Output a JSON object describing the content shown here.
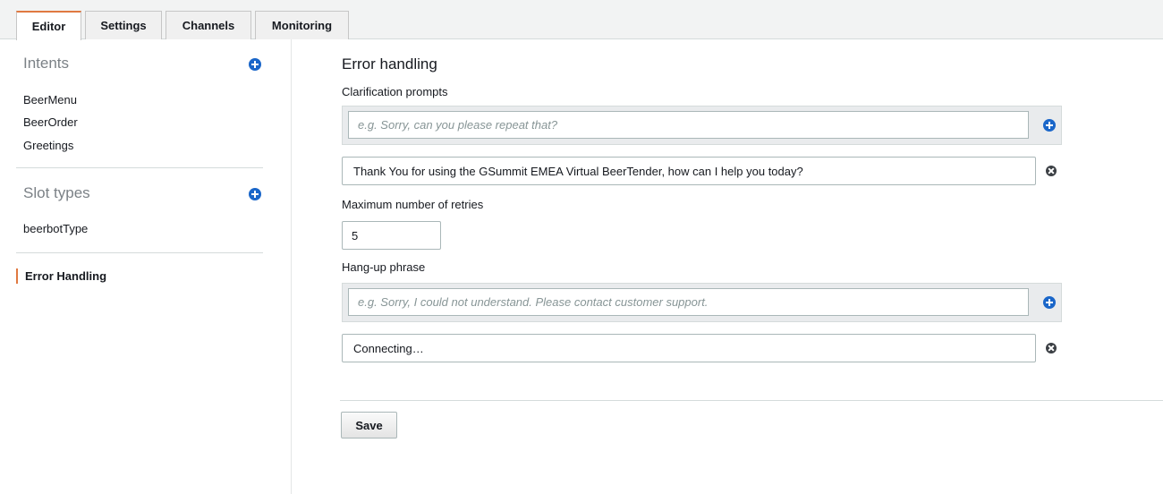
{
  "tabs": [
    {
      "label": "Editor",
      "active": true
    },
    {
      "label": "Settings",
      "active": false
    },
    {
      "label": "Channels",
      "active": false
    },
    {
      "label": "Monitoring",
      "active": false
    }
  ],
  "sidebar": {
    "intents_heading": "Intents",
    "intents": [
      "BeerMenu",
      "BeerOrder",
      "Greetings"
    ],
    "slot_types_heading": "Slot types",
    "slot_types": [
      "beerbotType"
    ],
    "error_handling": "Error Handling"
  },
  "main": {
    "title": "Error handling",
    "clarification": {
      "label": "Clarification prompts",
      "placeholder": "e.g. Sorry, can you please repeat that?",
      "value": "Thank You for using the GSummit EMEA Virtual BeerTender, how can I help you today?"
    },
    "retries": {
      "label": "Maximum number of retries",
      "value": "5"
    },
    "hangup": {
      "label": "Hang-up phrase",
      "placeholder": "e.g. Sorry, I could not understand. Please contact customer support.",
      "value": "Connecting…"
    },
    "save_label": "Save"
  },
  "colors": {
    "accent": "#e07941",
    "add_icon": "#1a66c9",
    "remove_icon": "#3b3f44"
  }
}
